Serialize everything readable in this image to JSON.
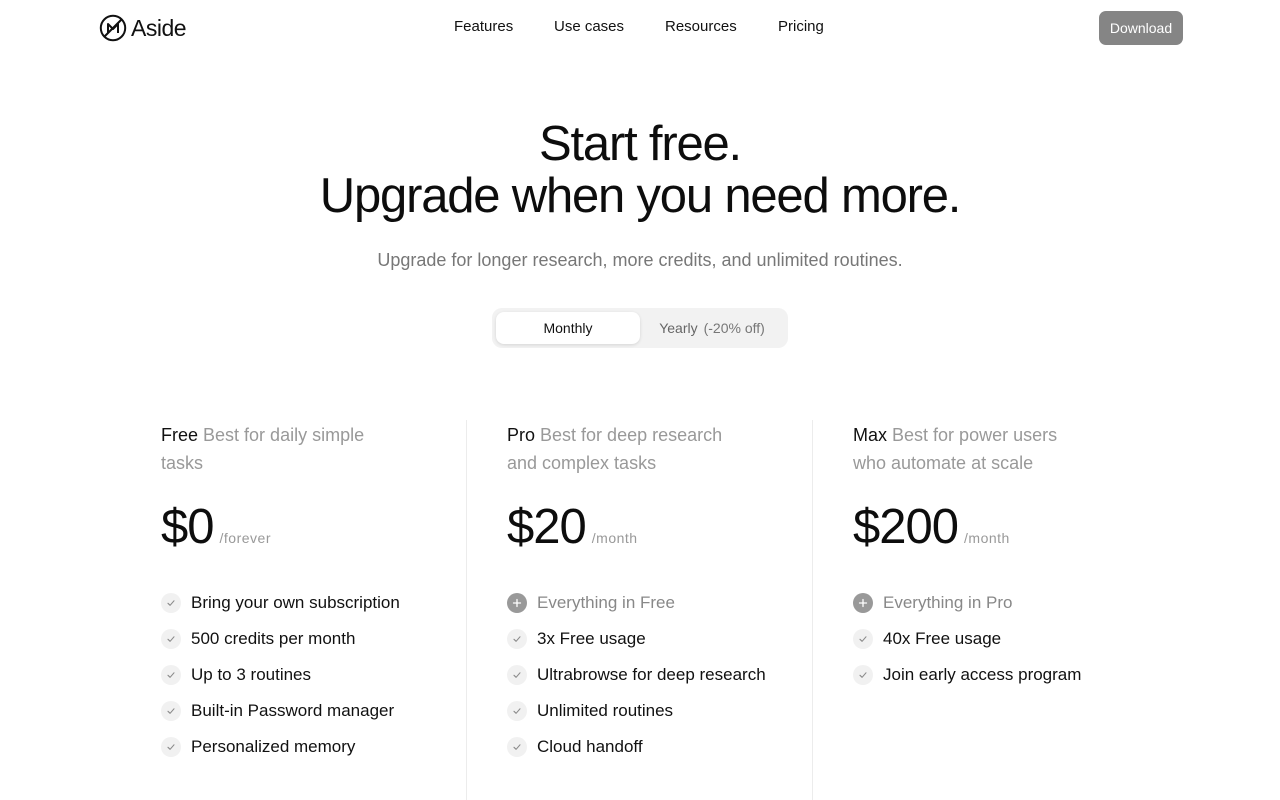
{
  "header": {
    "logo_text": "Aside",
    "nav": [
      "Features",
      "Use cases",
      "Resources",
      "Pricing"
    ],
    "download_label": "Download"
  },
  "hero": {
    "title_line1": "Start free.",
    "title_line2": "Upgrade when you need more.",
    "subtitle": "Upgrade for longer research, more credits, and unlimited routines."
  },
  "billing_toggle": {
    "monthly_label": "Monthly",
    "yearly_label": "Yearly",
    "yearly_discount": "(-20% off)",
    "selected": "Monthly"
  },
  "plans": [
    {
      "name": "Free",
      "description": "Best for daily simple tasks",
      "price": "$0",
      "period": "/forever",
      "features": [
        {
          "text": "Bring your own subscription",
          "icon": "check-icon"
        },
        {
          "text": "500 credits per month",
          "icon": "check-icon"
        },
        {
          "text": "Up to 3 routines",
          "icon": "check-icon"
        },
        {
          "text": "Built-in Password manager",
          "icon": "check-icon"
        },
        {
          "text": "Personalized memory",
          "icon": "check-icon"
        }
      ]
    },
    {
      "name": "Pro",
      "description": "Best for deep research and complex tasks",
      "price": "$20",
      "period": "/month",
      "features": [
        {
          "text": "Everything in Free",
          "icon": "plus-icon"
        },
        {
          "text": "3x Free usage",
          "icon": "check-icon"
        },
        {
          "text": "Ultrabrowse for deep research",
          "icon": "check-icon"
        },
        {
          "text": "Unlimited routines",
          "icon": "check-icon"
        },
        {
          "text": "Cloud handoff",
          "icon": "check-icon"
        }
      ]
    },
    {
      "name": "Max",
      "description": "Best for power users who automate at scale",
      "price": "$200",
      "period": "/month",
      "features": [
        {
          "text": "Everything in Pro",
          "icon": "plus-icon"
        },
        {
          "text": "40x Free usage",
          "icon": "check-icon"
        },
        {
          "text": "Join early access program",
          "icon": "check-icon"
        }
      ]
    }
  ],
  "colors": {
    "download_button": "#858585",
    "muted_text": "#999999",
    "toggle_bg": "#f2f2f2"
  }
}
